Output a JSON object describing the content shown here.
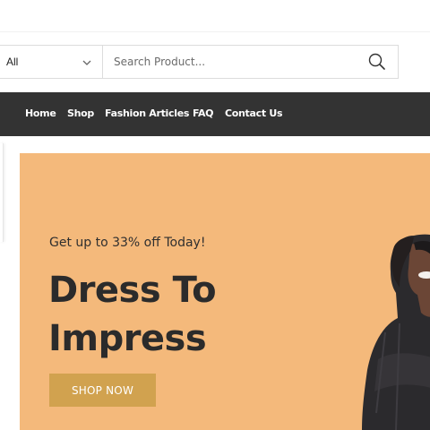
{
  "search": {
    "category_value": "All",
    "placeholder": "Search Product..."
  },
  "nav": {
    "items": [
      {
        "label": "Home"
      },
      {
        "label": "Shop"
      },
      {
        "label": "Fashion Articles"
      },
      {
        "label": "FAQ"
      },
      {
        "label": "Contact Us"
      }
    ]
  },
  "hero": {
    "subtitle": "Get up to 33% off Today!",
    "title_line1": "Dress To",
    "title_line2": "Impress",
    "cta_label": "SHOP NOW"
  },
  "colors": {
    "nav_bg": "#333333",
    "hero_bg": "#f4b97b",
    "cta_bg": "#d1a24f"
  },
  "icons": {
    "category_dropdown": "chevron-down-icon",
    "search": "search-icon"
  }
}
